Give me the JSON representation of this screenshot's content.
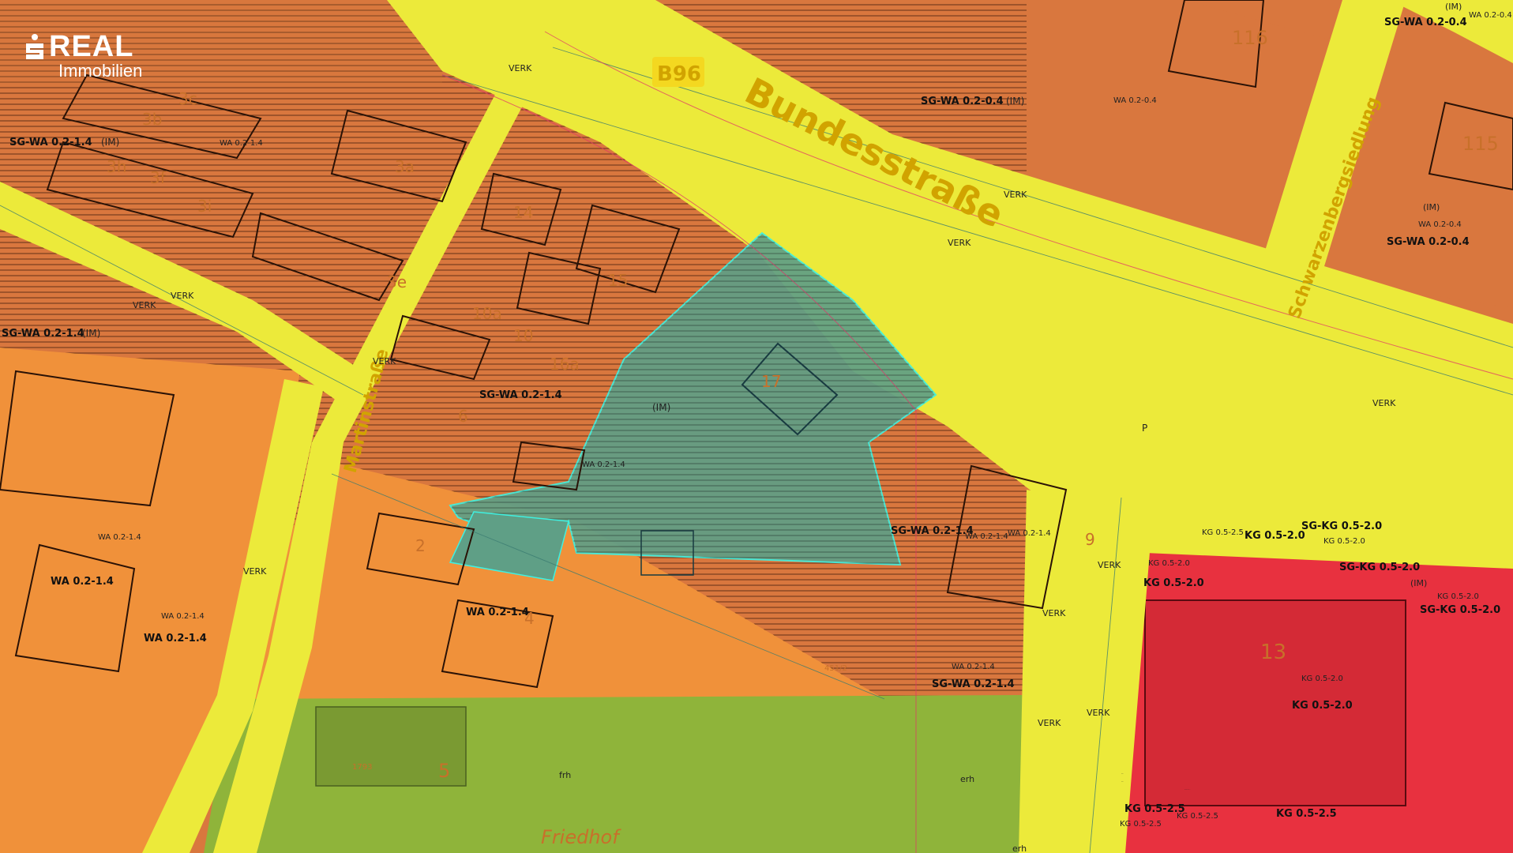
{
  "brand": {
    "name": "REAL",
    "tagline": "Immobilien",
    "icon": "sparkasse-s-icon",
    "color": "#ffffff"
  },
  "colors": {
    "road_yellow": "#ecea3a",
    "residential_dark_orange": "#d9773e",
    "residential_orange": "#f0913a",
    "core_red": "#e8313f",
    "cemetery_green": "#8fb43a",
    "parcel_teal": "#5f9f86"
  },
  "road": {
    "badge": "B96",
    "name": "Bundesstraße",
    "side_street": "Schwarzenbergsiedlung",
    "left_street": "Martinstraße",
    "bottom_label": "Friedhof"
  },
  "zone_labels": [
    "SG-WA 0.2-1.4",
    "(IM)",
    "WA 0.2-1.4",
    "SG-WA 0.2-1.4",
    "(IM)",
    "SG-WA 0.2-1.4",
    "(IM)",
    "WA 0.2-1.4",
    "WA 0.2-1.4",
    "SG-WA 0.2-1.4",
    "WA 0.2-1.4",
    "WA 0.2-1.4",
    "WA 0.2-1.4",
    "WA 0.2-1.4",
    "WA 0.2-1.4",
    "WA 0.2-1.4",
    "SG-WA 0.2-1.4",
    "WA 0.2-1.4",
    "SG-WA 0.2-1.4",
    "SG-WA 0.2-0.4",
    "(IM)",
    "WA 0.2-0.4",
    "SG-WA 0.2-0.4",
    "(IM)",
    "WA 0.2-0.4",
    "(IM)",
    "WA 0.2-0.4",
    "SG-WA 0.2-0.4",
    "SG-KG 0.5-2.0",
    "KG 0.5-2.5",
    "KG 0.5-2.0",
    "KG 0.5-2.0",
    "KG 0.5-2.0",
    "KG 0.5-2.0",
    "SG-KG 0.5-2.0",
    "(IM)",
    "KG 0.5-2.0",
    "SG-KG 0.5-2.0",
    "KG 0.5-2.0",
    "KG 0.5-2.0",
    "KG 0.5-2.5",
    "KG 0.5-2.5",
    "KG 0.5-2.5",
    "KG 0.5-2.5"
  ],
  "verk_labels": [
    "VERK",
    "VERK",
    "VERK",
    "VERK",
    "VERK",
    "VERK",
    "VERK",
    "VERK",
    "VERK",
    "VERK",
    "VERK",
    "VERK",
    "VERK",
    "VERK"
  ],
  "house_numbers": [
    "3c",
    "3b",
    "3h",
    "3f",
    "3i",
    "3a",
    "3e",
    "14",
    "15",
    "10a",
    "10",
    "16a",
    "6",
    "17",
    "9",
    "2",
    "4",
    "13",
    "5",
    "116",
    "115"
  ],
  "other_labels": [
    "P",
    "frh",
    "erh",
    "erh",
    "451/2",
    "1793"
  ]
}
